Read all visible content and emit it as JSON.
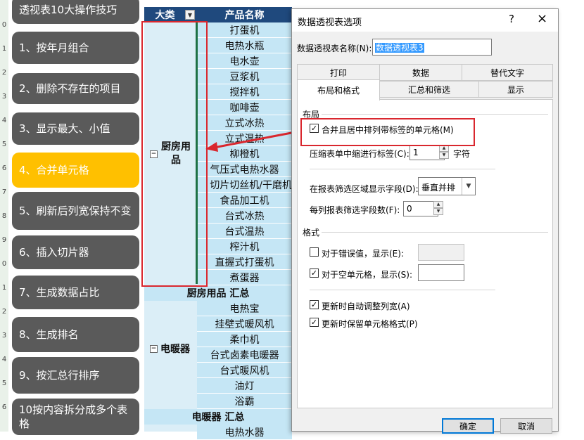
{
  "left_edge_numbers": [
    "0",
    "1",
    "2",
    "3",
    "4",
    "5",
    "6",
    "7",
    "8",
    "9",
    "0",
    "1",
    "2",
    "3",
    "4",
    "5",
    "6"
  ],
  "menu": {
    "items": [
      {
        "label": "透视表10大操作技巧",
        "active": false
      },
      {
        "label": "1、按年月组合",
        "active": false
      },
      {
        "label": "2、删除不存在的项目",
        "active": false
      },
      {
        "label": "3、显示最大、小值",
        "active": false
      },
      {
        "label": "4、合并单元格",
        "active": true
      },
      {
        "label": "5、刷新后列宽保持不变",
        "active": false
      },
      {
        "label": "6、插入切片器",
        "active": false
      },
      {
        "label": "7、生成数据占比",
        "active": false
      },
      {
        "label": "8、生成排名",
        "active": false
      },
      {
        "label": "9、按汇总行排序",
        "active": false
      },
      {
        "label": "10按内容拆分成多个表格",
        "active": false
      }
    ]
  },
  "pivot": {
    "header_category": "大类",
    "header_product": "产品名称",
    "dropdown_icon": "▼",
    "group1": {
      "label": "厨房用品",
      "toggle": "−",
      "items": [
        "打蛋机",
        "电热水瓶",
        "电水壶",
        "豆浆机",
        "搅拌机",
        "咖啡壶",
        "立式冰热",
        "立式温热",
        "柳橙机",
        "气压式电热水器",
        "切片切丝机/干磨机",
        "食品加工机",
        "台式冰热",
        "台式温热",
        "榨汁机",
        "直握式打蛋机",
        "煮蛋器"
      ],
      "subtotal": "厨房用品 汇总"
    },
    "group2": {
      "label": "电暖器",
      "toggle": "−",
      "items": [
        "电热宝",
        "挂壁式暖风机",
        "柔巾机",
        "台式卤素电暖器",
        "台式暖风机",
        "油灯",
        "浴霸"
      ],
      "subtotal": "电暖器 汇总"
    },
    "partial_next_row": "电热水器"
  },
  "dialog": {
    "title": "数据透视表选项",
    "help": "?",
    "close": "×",
    "name_label": "数据透视表名称(N):",
    "name_value": "数据透视表3",
    "tabs_row1": [
      "打印",
      "数据",
      "替代文字"
    ],
    "tabs_row2": [
      "布局和格式",
      "汇总和筛选",
      "显示"
    ],
    "selected_tab": "布局和格式",
    "layout_group": "布局",
    "merge_label": "合并且居中排列带标签的单元格(M)",
    "merge_checked": true,
    "indent_label": "压缩表单中缩进行标签(C):",
    "indent_value": "1",
    "indent_unit": "字符",
    "filter_area_label": "在报表筛选区域显示字段(D):",
    "filter_area_value": "垂直并排",
    "filter_fields_label": "每列报表筛选字段数(F):",
    "filter_fields_value": "0",
    "format_group": "格式",
    "error_label": "对于错误值，显示(E):",
    "error_checked": false,
    "empty_label": "对于空单元格，显示(S):",
    "empty_checked": true,
    "autofit_label": "更新时自动调整列宽(A)",
    "autofit_checked": true,
    "preserve_label": "更新时保留单元格格式(P)",
    "preserve_checked": true,
    "ok": "确定",
    "cancel": "取消"
  },
  "colors": {
    "menu_bg": "#5a5a5a",
    "menu_active": "#ffc000",
    "header_bg": "#1f497d",
    "row_bg": "#c5e6f5",
    "highlight_red": "#d9272e"
  }
}
